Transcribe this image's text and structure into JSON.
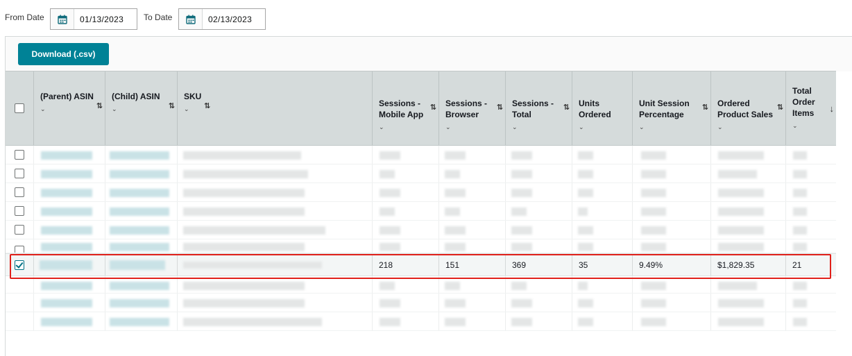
{
  "filters": {
    "from_label": "From Date",
    "from_value": "01/13/2023",
    "to_label": "To Date",
    "to_value": "02/13/2023",
    "calendar_icon": "calendar-icon"
  },
  "toolbar": {
    "download_label": "Download (.csv)"
  },
  "colors": {
    "accent": "#008296",
    "header_bg": "#d5dbdb",
    "highlight": "#e0201a"
  },
  "table": {
    "headers": [
      {
        "label": "(Parent) ASIN",
        "sort": "⇅"
      },
      {
        "label": "(Child) ASIN",
        "sort": "⇅"
      },
      {
        "label": "SKU",
        "sort": "⇅"
      },
      {
        "label": "Sessions - Mobile App",
        "sort": "⇅"
      },
      {
        "label": "Sessions - Browser",
        "sort": "⇅"
      },
      {
        "label": "Sessions - Total",
        "sort": "⇅"
      },
      {
        "label": "Units Ordered",
        "sort": "⇅"
      },
      {
        "label": "Unit Session Percentage",
        "sort": "⇅"
      },
      {
        "label": "Ordered Product Sales",
        "sort": "⇅"
      },
      {
        "label": "Total Order Items",
        "sort": "↓"
      }
    ],
    "selected_row": {
      "sessions_mobile": "218",
      "sessions_browser": "151",
      "sessions_total": "369",
      "units_ordered": "35",
      "unit_session_pct": "9.49%",
      "ordered_sales": "$1,829.35",
      "total_order_items": "21"
    }
  }
}
